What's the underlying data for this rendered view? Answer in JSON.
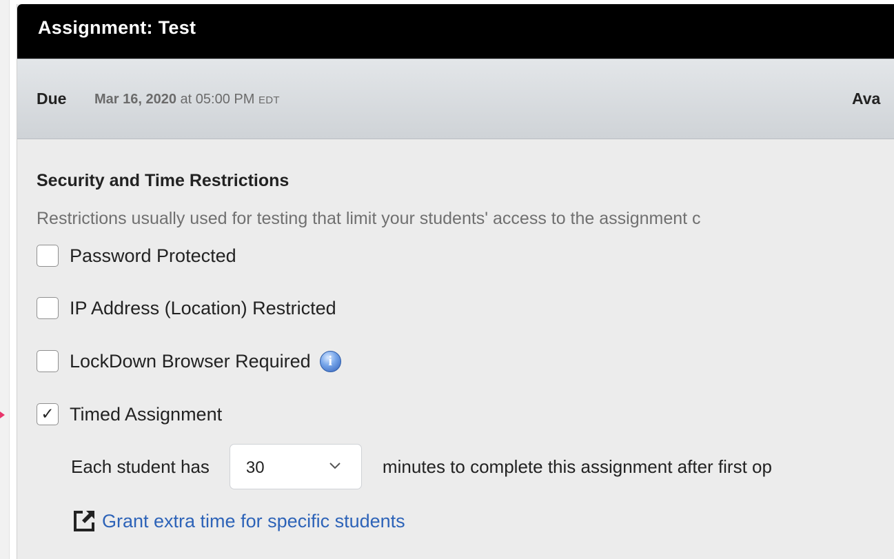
{
  "assignment": {
    "title": "Assignment: Test"
  },
  "due": {
    "label": "Due",
    "date": "Mar 16, 2020",
    "connector": " at 05:00 PM ",
    "timezone": "EDT",
    "available_label": "Ava"
  },
  "security": {
    "title": "Security and Time Restrictions",
    "description": "Restrictions usually used for testing that limit your students' access to the assignment c",
    "options": [
      {
        "label": "Password Protected",
        "checked": false,
        "mark": ""
      },
      {
        "label": "IP Address (Location) Restricted",
        "checked": false,
        "mark": ""
      },
      {
        "label": "LockDown Browser Required",
        "checked": false,
        "mark": ""
      },
      {
        "label": "Timed Assignment",
        "checked": true,
        "mark": "✓"
      }
    ],
    "info_icon": {
      "name": "info-icon",
      "glyph": "i",
      "color": "#3a68c4"
    }
  },
  "timed": {
    "prefix": "Each student has",
    "minutes": "30",
    "suffix": "minutes to complete this assignment after first op"
  },
  "grant_extra_time": {
    "label": "Grant extra time for specific students",
    "icon": "external-link-icon",
    "color": "#2d63b8"
  },
  "colors": {
    "pointer_arrow": "#e8356b",
    "header": "#000000",
    "panel_background": "#ececec"
  }
}
